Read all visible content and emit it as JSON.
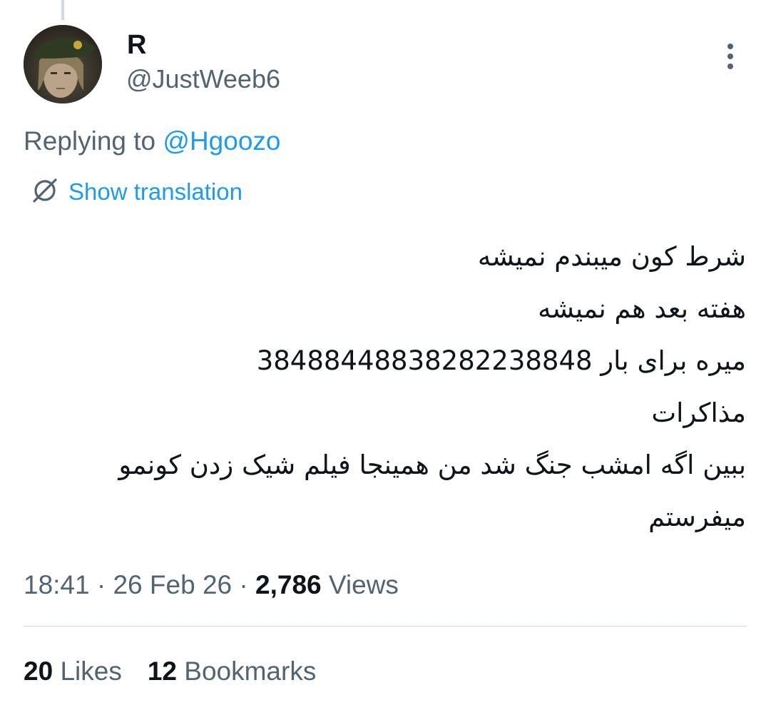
{
  "author": {
    "display_name": "R",
    "handle": "@JustWeeb6",
    "avatar_icon": "profile-photo"
  },
  "reply": {
    "prefix": "Replying to",
    "mention": "@Hgoozo"
  },
  "translation": {
    "label": "Show translation",
    "icon": "globe-icon"
  },
  "tweet": {
    "lines": [
      "شرط کون میبندم نمیشه",
      "هفته بعد هم نمیشه",
      "میره برای بار 3848844883828223884​8",
      "مذاکرات",
      "ببین اگه امشب جنگ شد من همینجا فیلم شیک زدن کونمو",
      "میفرستم"
    ]
  },
  "meta": {
    "time": "18:41",
    "separator": "·",
    "date": "26 Feb 26",
    "views_count": "2,786",
    "views_label": "Views"
  },
  "stats": {
    "likes_count": "20",
    "likes_label": "Likes",
    "bookmarks_count": "12",
    "bookmarks_label": "Bookmarks"
  },
  "colors": {
    "link": "#1d9bf0",
    "secondary_text": "#536471",
    "primary_text": "#0f1419",
    "divider": "#cfd9de"
  }
}
